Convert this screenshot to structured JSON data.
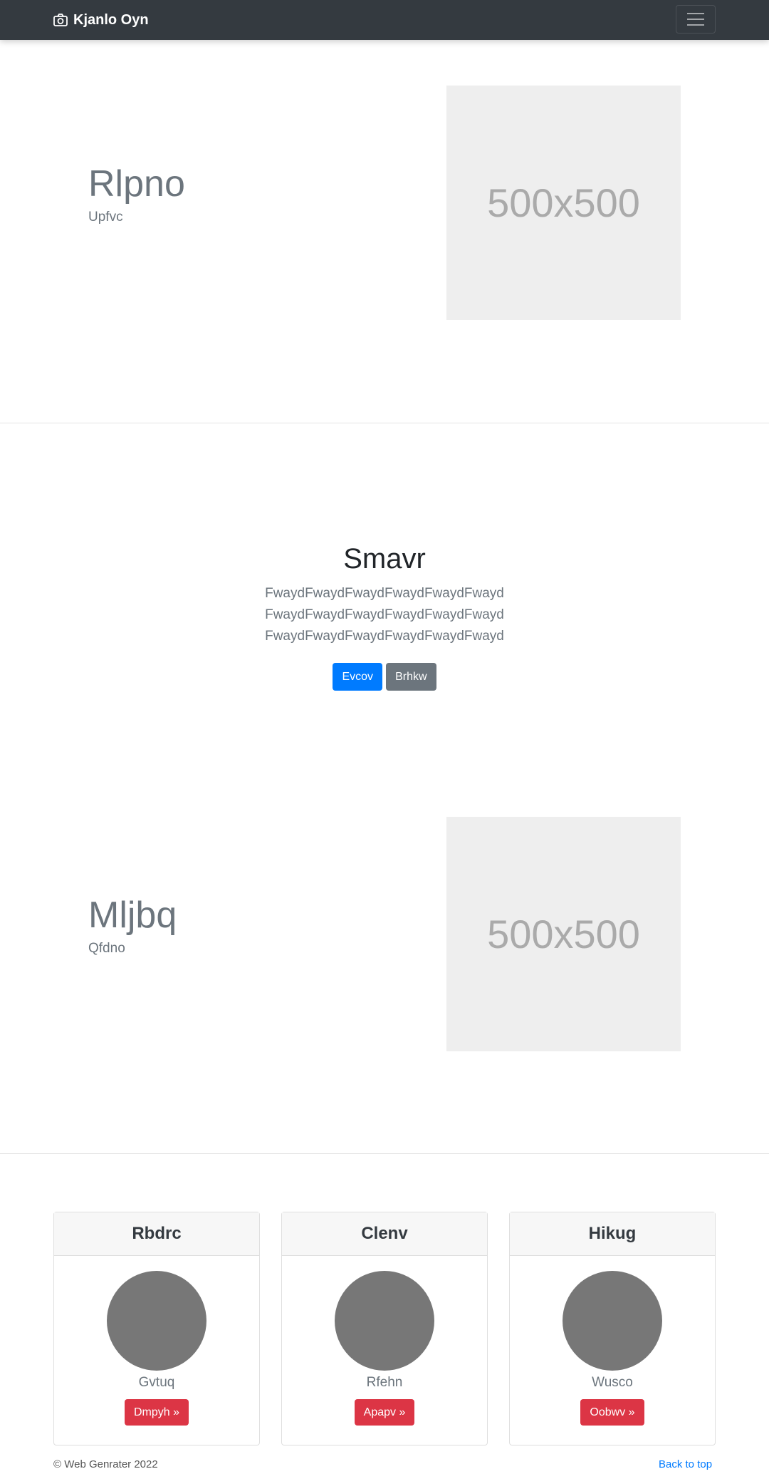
{
  "navbar": {
    "brand": "Kjanlo Oyn"
  },
  "feature1": {
    "heading": "Rlpno",
    "lead": "Upfvc",
    "image_label": "500x500"
  },
  "jumbotron": {
    "title": "Smavr",
    "lines": [
      "FwaydFwaydFwaydFwaydFwaydFwayd",
      "FwaydFwaydFwaydFwaydFwaydFwayd",
      "FwaydFwaydFwaydFwaydFwaydFwayd"
    ],
    "primary_button": "Evcov",
    "secondary_button": "Brhkw"
  },
  "feature2": {
    "heading": "Mljbq",
    "lead": "Qfdno",
    "image_label": "500x500"
  },
  "cards": [
    {
      "title": "Rbdrc",
      "name": "Gvtuq",
      "button": "Dmpyh »"
    },
    {
      "title": "Clenv",
      "name": "Rfehn",
      "button": "Apapv »"
    },
    {
      "title": "Hikug",
      "name": "Wusco",
      "button": "Oobwv »"
    }
  ],
  "footer": {
    "copyright": "© Web Genrater 2022",
    "back_to_top": "Back to top"
  }
}
